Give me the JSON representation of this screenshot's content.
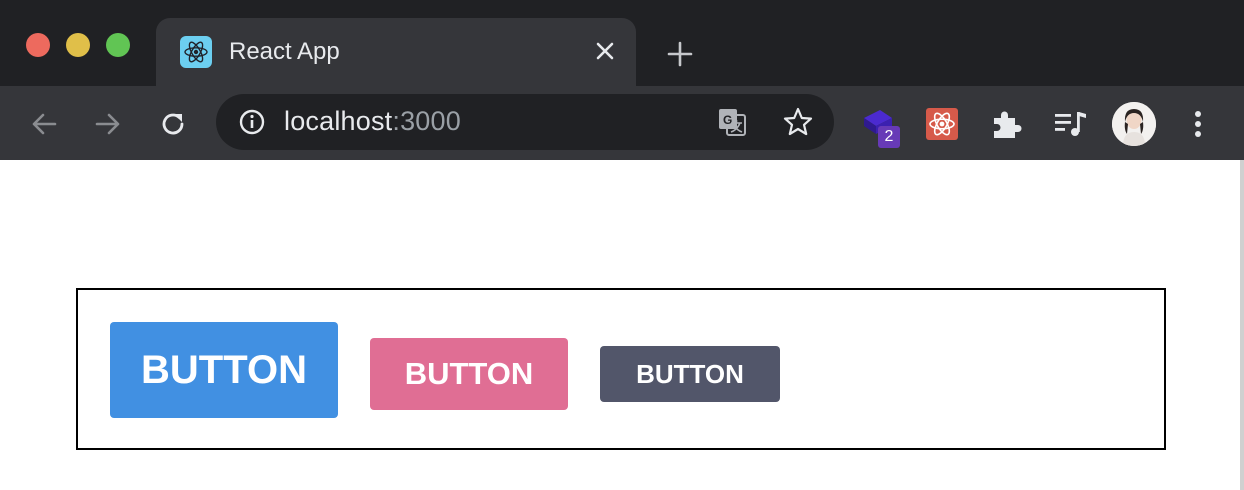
{
  "browser": {
    "tab": {
      "title": "React App",
      "favicon": "react-logo-icon"
    },
    "omnibox": {
      "host": "localhost",
      "port": ":3000"
    },
    "extensions": [
      {
        "name": "stack-extension-icon",
        "badge": "2"
      },
      {
        "name": "react-devtools-icon"
      },
      {
        "name": "puzzle-icon"
      },
      {
        "name": "media-queue-icon"
      }
    ]
  },
  "buttons": [
    {
      "label": "BUTTON",
      "color": "#4190e2"
    },
    {
      "label": "BUTTON",
      "color": "#e06e94"
    },
    {
      "label": "BUTTON",
      "color": "#52566a"
    }
  ],
  "colors": {
    "tabstrip": "#202124",
    "tab_active": "#35363a",
    "traffic_red": "#ed6a5e",
    "traffic_yellow": "#e0bf49",
    "traffic_green": "#61c554"
  }
}
